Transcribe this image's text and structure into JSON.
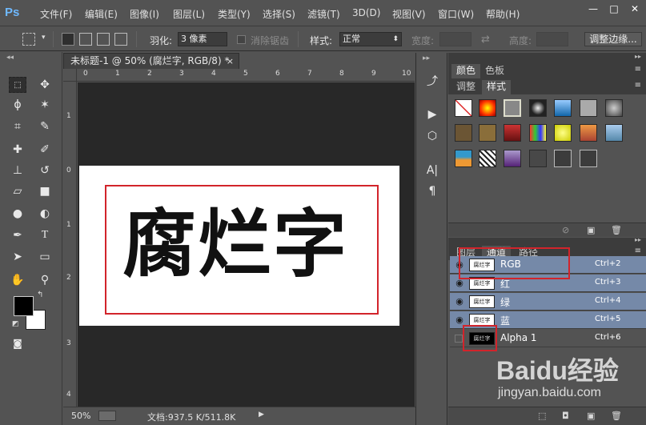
{
  "app": {
    "logo": "Ps"
  },
  "menu": [
    "文件(F)",
    "编辑(E)",
    "图像(I)",
    "图层(L)",
    "类型(Y)",
    "选择(S)",
    "滤镜(T)",
    "3D(D)",
    "视图(V)",
    "窗口(W)",
    "帮助(H)"
  ],
  "window_controls": {
    "minimize": "—",
    "restore": "□",
    "close": "✕"
  },
  "options": {
    "feather_label": "羽化:",
    "feather_value": "3 像素",
    "antialias_label": "消除锯齿",
    "style_label": "样式:",
    "style_value": "正常",
    "width_label": "宽度:",
    "height_label": "高度:",
    "refine_edge_label": "调整边缘..."
  },
  "document": {
    "tab_title": "未标题-1 @ 50% (腐烂字, RGB/8) *",
    "canvas_text": "腐烂字",
    "ruler_h": [
      "0",
      "1",
      "2",
      "3",
      "4",
      "5",
      "6",
      "7",
      "8",
      "9",
      "10"
    ],
    "ruler_v": [
      "1",
      "0",
      "1",
      "2",
      "3",
      "4"
    ]
  },
  "status": {
    "zoom": "50%",
    "doc_info": "文档:937.5 K/511.8K"
  },
  "panels": {
    "top_tabs": [
      "颜色",
      "色板"
    ],
    "mid_tabs": [
      "调整",
      "样式"
    ],
    "bottom_tabs": [
      "图层",
      "通道",
      "路径"
    ],
    "channels": [
      {
        "name": "RGB",
        "shortcut": "Ctrl+2",
        "thumb": "腐烂字"
      },
      {
        "name": "红",
        "shortcut": "Ctrl+3",
        "thumb": "腐烂字"
      },
      {
        "name": "绿",
        "shortcut": "Ctrl+4",
        "thumb": "腐烂字"
      },
      {
        "name": "蓝",
        "shortcut": "Ctrl+5",
        "thumb": "腐烂字"
      },
      {
        "name": "Alpha 1",
        "shortcut": "Ctrl+6",
        "thumb": "腐烂字"
      }
    ]
  },
  "watermark": {
    "brand": "Baidu经验",
    "url": "jingyan.baidu.com"
  },
  "colors": {
    "highlight_red": "#d2242b",
    "selected_row": "#7589a8",
    "canvas_bg": "#282828"
  }
}
